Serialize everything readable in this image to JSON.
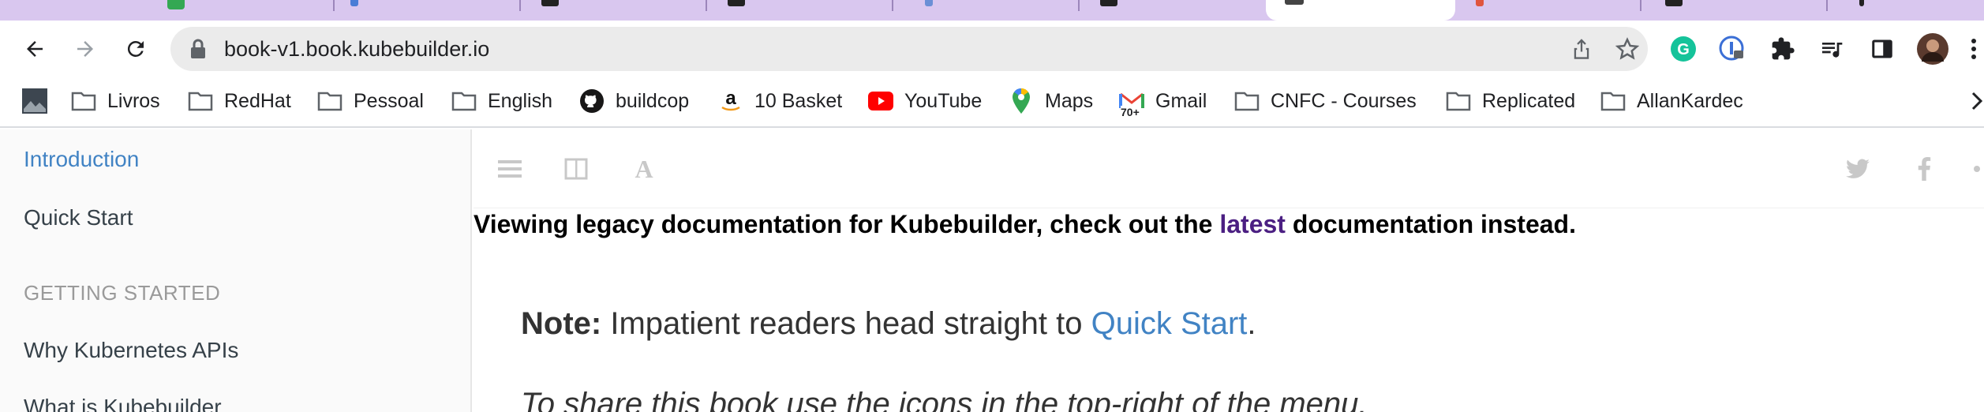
{
  "browser": {
    "url": "book-v1.book.kubebuilder.io",
    "bookmarks": [
      {
        "label": "",
        "icon": "image-thumbnail-icon"
      },
      {
        "label": "Livros",
        "icon": "folder-icon"
      },
      {
        "label": "RedHat",
        "icon": "folder-icon"
      },
      {
        "label": "Pessoal",
        "icon": "folder-icon"
      },
      {
        "label": "English",
        "icon": "folder-icon"
      },
      {
        "label": "buildcop",
        "icon": "github-icon"
      },
      {
        "label": "10 Basket",
        "icon": "amazon-icon"
      },
      {
        "label": "YouTube",
        "icon": "youtube-icon"
      },
      {
        "label": "Maps",
        "icon": "maps-pin-icon"
      },
      {
        "label": "Gmail",
        "icon": "gmail-icon",
        "badge": "70+"
      },
      {
        "label": "CNFC - Courses",
        "icon": "folder-icon"
      },
      {
        "label": "Replicated",
        "icon": "folder-icon"
      },
      {
        "label": "AllanKardec",
        "icon": "folder-icon"
      }
    ],
    "colors": {
      "tab_strip": "#d9c7ef",
      "omnibox": "#ebebeb",
      "grammarly": "#15c39a"
    }
  },
  "sidebar": {
    "items": [
      {
        "label": "Introduction",
        "active": true
      },
      {
        "label": "Quick Start",
        "active": false
      }
    ],
    "section_header": "GETTING STARTED",
    "section_items": [
      {
        "label": "Why Kubernetes APIs"
      },
      {
        "label": "What is Kubebuilder"
      }
    ]
  },
  "content": {
    "banner_pre": "Viewing legacy documentation for Kubebuilder, check out the ",
    "banner_link": "latest",
    "banner_post": " documentation instead.",
    "note_label": "Note:",
    "note_text": " Impatient readers head straight to ",
    "note_link": "Quick Start",
    "note_end": ".",
    "share_text": "To share this book use the icons in the top-right of the menu."
  }
}
